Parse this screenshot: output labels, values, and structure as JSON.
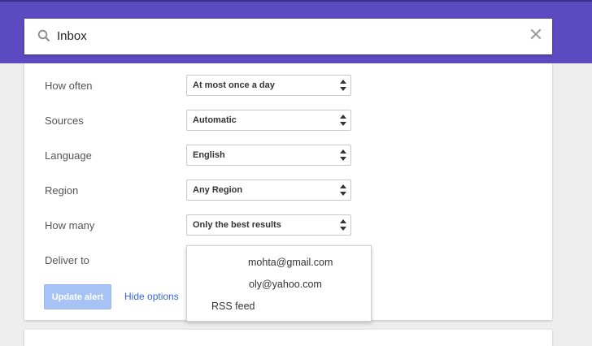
{
  "search": {
    "query": "Inbox"
  },
  "options": {
    "rows": [
      {
        "label": "How often",
        "value": "At most once a day"
      },
      {
        "label": "Sources",
        "value": "Automatic"
      },
      {
        "label": "Language",
        "value": "English"
      },
      {
        "label": "Region",
        "value": "Any Region"
      },
      {
        "label": "How many",
        "value": "Only the best results"
      }
    ],
    "deliver_label": "Deliver to"
  },
  "actions": {
    "update_label": "Update alert",
    "hide_label": "Hide options"
  },
  "deliver_menu": {
    "items": [
      "mohta@gmail.com",
      "oly@yahoo.com",
      "RSS feed"
    ]
  },
  "colors": {
    "header": "#5c4ac1",
    "link": "#3367d6",
    "button": "#a7c3f5"
  },
  "icons": {
    "search": "search-icon",
    "close": "close-icon",
    "arrows": "updown-arrows-icon"
  }
}
